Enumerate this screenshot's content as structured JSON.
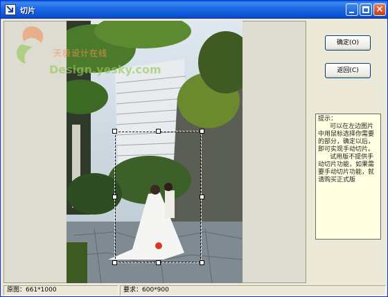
{
  "window": {
    "title": "切片"
  },
  "watermark": {
    "text_cn": "天极设计在线",
    "text_en": "Design.yesky.com"
  },
  "buttons": {
    "ok": "确定(O)",
    "back": "返回(C)"
  },
  "hint": {
    "title": "提示：",
    "body": "      可以在左边图片中用鼠标选择你需要的部分，确定以后，即可实现手动切片。\n      试用版不提供手动切片功能，如果需要手动切片功能，就请购买正式版"
  },
  "status": {
    "original": "原图：661*1000",
    "required": "要求：600*900"
  },
  "colors": {
    "titlebar": "#0b55d6",
    "hint_bg": "#ffffe1",
    "window_bg": "#ece9d8"
  }
}
